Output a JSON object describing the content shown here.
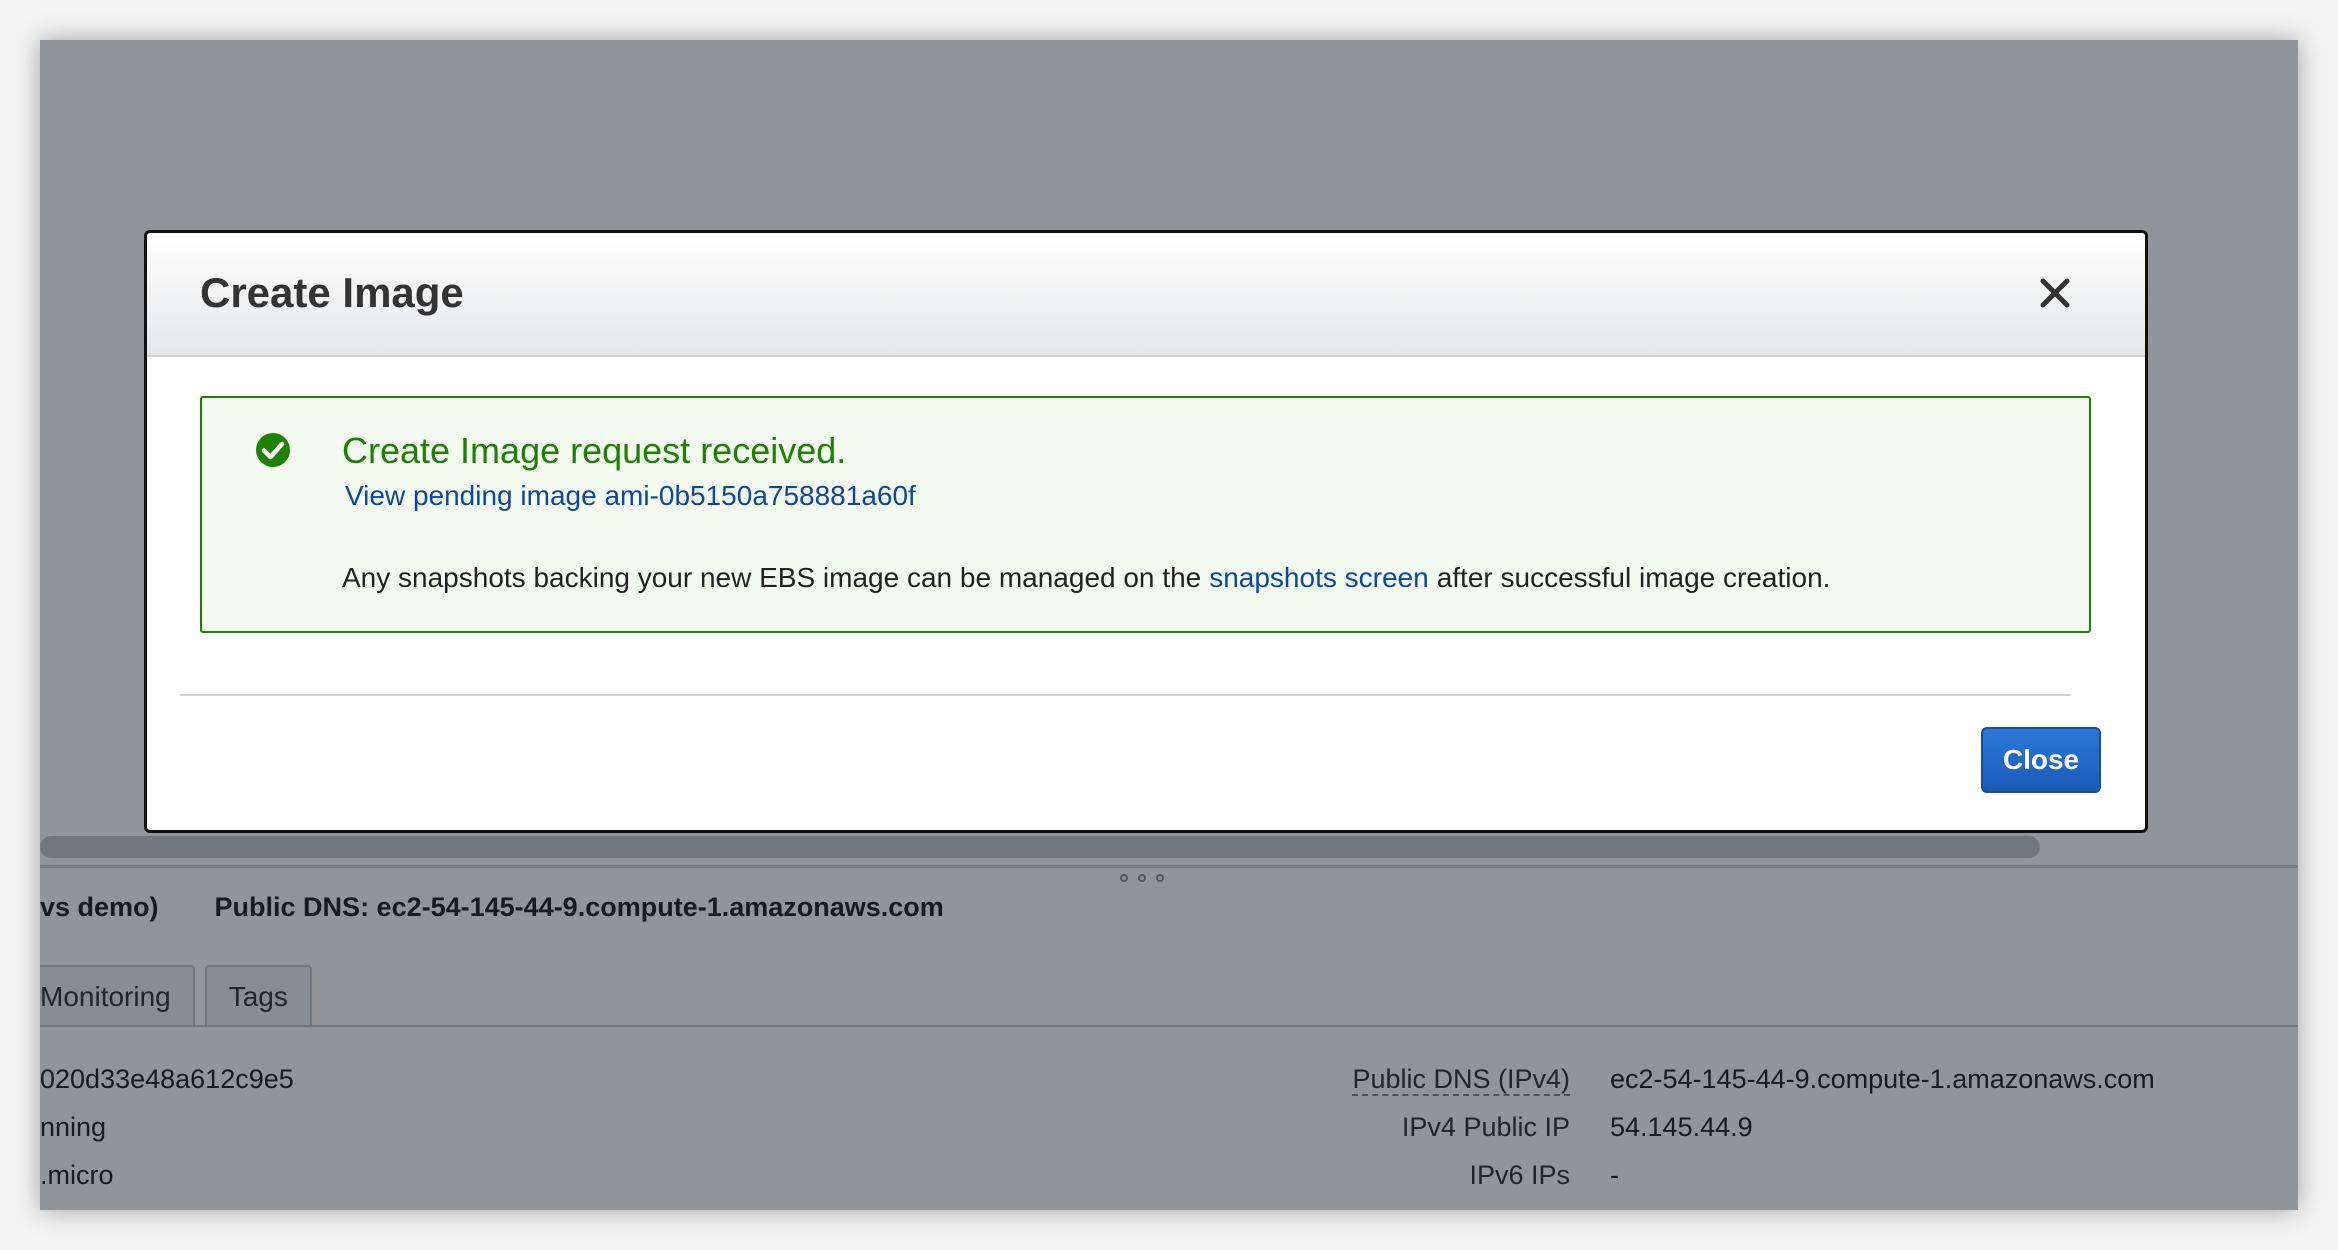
{
  "background": {
    "summary": {
      "instance_name_fragment": "vs demo)",
      "public_dns_label": "Public DNS: ec2-54-145-44-9.compute-1.amazonaws.com"
    },
    "tabs": [
      {
        "label": "Monitoring"
      },
      {
        "label": "Tags"
      }
    ],
    "left_values": [
      "020d33e48a612c9e5",
      "nning",
      ".micro"
    ],
    "properties": [
      {
        "label": "Public DNS (IPv4)",
        "value": "ec2-54-145-44-9.compute-1.amazonaws.com"
      },
      {
        "label": "IPv4 Public IP",
        "value": "54.145.44.9"
      },
      {
        "label": "IPv6 IPs",
        "value": "-"
      }
    ]
  },
  "modal": {
    "title": "Create Image",
    "alert": {
      "title": "Create Image request received.",
      "link": "View pending image ami-0b5150a758881a60f",
      "note_before": "Any snapshots backing your new EBS image can be managed on the",
      "note_link": "snapshots screen",
      "note_after": "after successful image creation."
    },
    "close_button": "Close"
  },
  "colors": {
    "success": "#1d8102",
    "link": "#0d47a1",
    "primary_button": "#1a5bb8"
  },
  "icons": [
    "close-icon",
    "check-circle-icon"
  ]
}
